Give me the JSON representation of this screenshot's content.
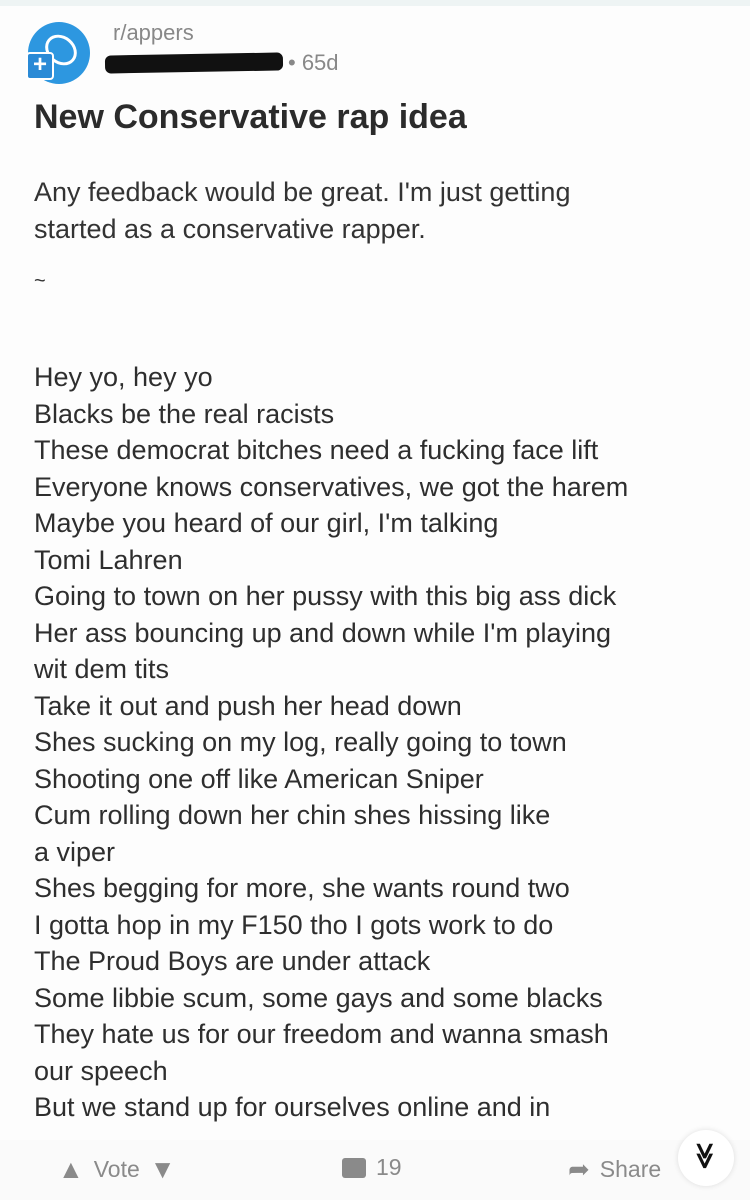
{
  "post": {
    "subreddit": "r/appers",
    "age": "• 65d",
    "title": "New Conservative rap idea",
    "intro": [
      "Any feedback would be great. I'm just getting",
      "started as a conservative rapper."
    ],
    "divider": "~",
    "lyrics": [
      "Hey yo, hey yo",
      "Blacks be the real racists",
      "These democrat bitches need a fucking face lift",
      "Everyone knows conservatives, we got the harem",
      "Maybe you heard of our girl, I'm talking",
      "Tomi Lahren",
      "Going to town on her pussy with this big ass dick",
      "Her ass bouncing up and down while I'm playing",
      "wit dem tits",
      "Take it out and push her head down",
      "Shes sucking on my log, really going to town",
      "Shooting one off like American Sniper",
      "Cum rolling down her chin shes hissing like",
      "a viper",
      "Shes begging for more, she wants round two",
      "I gotta hop in my F150 tho I gots work to do",
      "The Proud Boys are under attack",
      "Some libbie scum, some gays and some blacks",
      "They hate us for our freedom and wanna smash",
      "our speech",
      "But we stand up for ourselves online and in"
    ]
  },
  "actions": {
    "vote": "Vote",
    "comments": "19",
    "share": "Share"
  },
  "icons": {
    "upvote": "▲",
    "downvote": "▼",
    "share": "➦",
    "scroll": "≫"
  }
}
